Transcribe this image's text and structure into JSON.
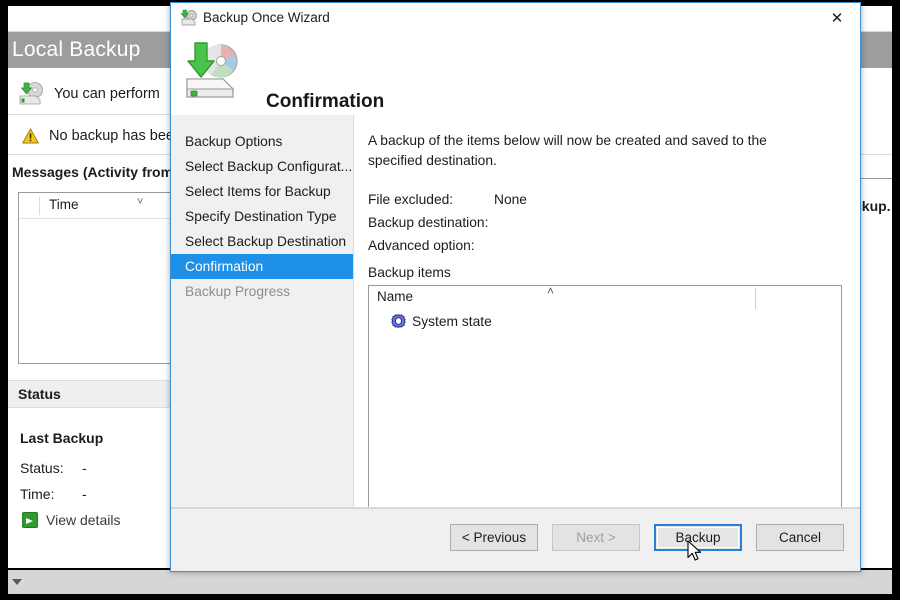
{
  "background_window": {
    "banner_title": "Local Backup",
    "perform_text": "You can perform",
    "no_backup_text": "No backup has been",
    "messages_label": "Messages (Activity from last",
    "right_truncated_text": "ckup.",
    "messages_table": {
      "columns": [
        "Time"
      ],
      "rows": [],
      "sort_indicator": "chevron-down"
    },
    "status_banner": "Status",
    "last_backup_heading": "Last Backup",
    "fields": [
      {
        "label": "Status:",
        "value": "-"
      },
      {
        "label": "Time:",
        "value": "-"
      }
    ],
    "view_details_label": "View details",
    "icons": {
      "banner_disk": "backup-disk-icon",
      "warning": "warning-triangle-icon",
      "view_details": "green-arrow-icon"
    }
  },
  "wizard": {
    "title": "Backup Once Wizard",
    "title_icon": "backup-once-wizard-icon",
    "close_label": "✕",
    "header_title": "Confirmation",
    "header_icon": "disk-with-down-arrow-icon",
    "nav": {
      "items": [
        {
          "label": "Backup Options",
          "state": "normal"
        },
        {
          "label": "Select Backup Configurat...",
          "state": "normal"
        },
        {
          "label": "Select Items for Backup",
          "state": "normal"
        },
        {
          "label": "Specify Destination Type",
          "state": "normal"
        },
        {
          "label": "Select Backup Destination",
          "state": "normal"
        },
        {
          "label": "Confirmation",
          "state": "active"
        },
        {
          "label": "Backup Progress",
          "state": "disabled"
        }
      ]
    },
    "content": {
      "intro": "A backup of the items below will now be created and saved to the specified destination.",
      "fields": [
        {
          "label": "File excluded:",
          "value": "None"
        },
        {
          "label": "Backup destination:",
          "value": ""
        },
        {
          "label": "Advanced option:",
          "value": ""
        }
      ],
      "backup_items_label": "Backup items",
      "listview": {
        "column_header": "Name",
        "sort_indicator": "chevron-up",
        "rows": [
          {
            "name": "System state",
            "icon": "system-state-gear-icon"
          }
        ]
      }
    },
    "buttons": [
      {
        "label": "< Previous",
        "state": "enabled"
      },
      {
        "label": "Next >",
        "state": "disabled"
      },
      {
        "label": "Backup",
        "state": "default"
      },
      {
        "label": "Cancel",
        "state": "enabled"
      }
    ]
  },
  "colors": {
    "accent_blue": "#1e90e8",
    "dialog_border": "#3a8fd4",
    "banner_gray": "#9d9d9d",
    "green": "#2f9c2f",
    "system_state_purple": "#5b5fc7"
  },
  "cursor": {
    "type": "arrow-pointer"
  }
}
